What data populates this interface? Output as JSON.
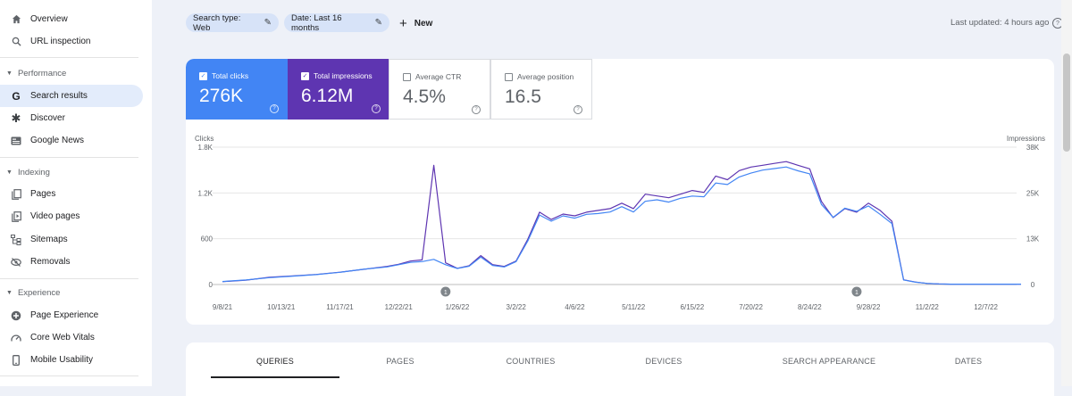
{
  "sidebar": {
    "items_top": [
      {
        "label": "Overview",
        "icon": "home-icon"
      },
      {
        "label": "URL inspection",
        "icon": "search-icon"
      }
    ],
    "sections": [
      {
        "title": "Performance",
        "items": [
          {
            "label": "Search results",
            "icon": "google-g-icon",
            "active": true
          },
          {
            "label": "Discover",
            "icon": "asterisk-icon"
          },
          {
            "label": "Google News",
            "icon": "news-icon"
          }
        ]
      },
      {
        "title": "Indexing",
        "items": [
          {
            "label": "Pages",
            "icon": "pages-icon"
          },
          {
            "label": "Video pages",
            "icon": "video-pages-icon"
          },
          {
            "label": "Sitemaps",
            "icon": "sitemap-icon"
          },
          {
            "label": "Removals",
            "icon": "removals-icon"
          }
        ]
      },
      {
        "title": "Experience",
        "items": [
          {
            "label": "Page Experience",
            "icon": "page-experience-icon"
          },
          {
            "label": "Core Web Vitals",
            "icon": "gauge-icon"
          },
          {
            "label": "Mobile Usability",
            "icon": "mobile-icon"
          }
        ]
      }
    ]
  },
  "filters": {
    "search_type": "Search type: Web",
    "date": "Date: Last 16 months",
    "new_label": "New"
  },
  "last_updated": "Last updated: 4 hours ago",
  "metrics": {
    "clicks": {
      "label": "Total clicks",
      "value": "276K",
      "checked": true,
      "color": "#4285f4"
    },
    "impressions": {
      "label": "Total impressions",
      "value": "6.12M",
      "checked": true,
      "color": "#5e35b1"
    },
    "ctr": {
      "label": "Average CTR",
      "value": "4.5%",
      "checked": false
    },
    "position": {
      "label": "Average position",
      "value": "16.5",
      "checked": false
    }
  },
  "chart_data": {
    "type": "line",
    "left_axis": {
      "label": "Clicks",
      "ticks": [
        "0",
        "600",
        "1.2K",
        "1.8K"
      ],
      "range": [
        0,
        1800
      ]
    },
    "right_axis": {
      "label": "Impressions",
      "ticks": [
        "0",
        "13K",
        "25K",
        "38K"
      ],
      "range": [
        0,
        38000
      ]
    },
    "x_tick_labels": [
      "9/8/21",
      "10/13/21",
      "11/17/21",
      "12/22/21",
      "1/26/22",
      "3/2/22",
      "4/6/22",
      "5/11/22",
      "6/15/22",
      "7/20/22",
      "8/24/22",
      "9/28/22",
      "11/2/22",
      "12/7/22"
    ],
    "annotations": [
      "1",
      "1"
    ],
    "series": [
      {
        "name": "Total clicks",
        "color": "#4285f4",
        "axis": "left",
        "x": [
          "9/8/21",
          "9/22/21",
          "10/6/21",
          "10/20/21",
          "11/3/21",
          "11/17/21",
          "12/1/21",
          "12/15/21",
          "12/22/21",
          "12/29/21",
          "1/5/22",
          "1/12/22",
          "1/19/22",
          "1/26/22",
          "2/2/22",
          "2/9/22",
          "2/16/22",
          "2/23/22",
          "3/2/22",
          "3/9/22",
          "3/16/22",
          "3/23/22",
          "3/30/22",
          "4/6/22",
          "4/13/22",
          "4/20/22",
          "4/27/22",
          "5/4/22",
          "5/11/22",
          "5/18/22",
          "5/25/22",
          "6/1/22",
          "6/8/22",
          "6/15/22",
          "6/22/22",
          "6/29/22",
          "7/6/22",
          "7/13/22",
          "7/20/22",
          "7/27/22",
          "8/3/22",
          "8/10/22",
          "8/17/22",
          "8/24/22",
          "8/31/22",
          "9/7/22",
          "9/14/22",
          "9/21/22",
          "9/28/22",
          "10/5/22",
          "10/12/22",
          "10/19/22",
          "10/26/22",
          "11/2/22",
          "11/9/22",
          "11/16/22",
          "11/23/22",
          "11/30/22",
          "12/7/22",
          "12/14/22",
          "12/21/22",
          "12/28/22"
        ],
        "y": [
          40,
          60,
          90,
          110,
          130,
          160,
          200,
          230,
          260,
          290,
          300,
          330,
          260,
          210,
          240,
          360,
          250,
          230,
          300,
          570,
          910,
          830,
          900,
          870,
          920,
          930,
          950,
          1020,
          950,
          1090,
          1110,
          1080,
          1130,
          1160,
          1150,
          1330,
          1310,
          1410,
          1460,
          1500,
          1520,
          1540,
          1490,
          1450,
          1050,
          880,
          1000,
          960,
          1030,
          920,
          800,
          60,
          30,
          15,
          8,
          5,
          5,
          5,
          5,
          5,
          5,
          5
        ]
      },
      {
        "name": "Total impressions",
        "color": "#5e35b1",
        "axis": "right",
        "x": [
          "9/8/21",
          "9/22/21",
          "10/6/21",
          "10/20/21",
          "11/3/21",
          "11/17/21",
          "12/1/21",
          "12/15/21",
          "12/22/21",
          "12/29/21",
          "1/5/22",
          "1/12/22",
          "1/19/22",
          "1/26/22",
          "2/2/22",
          "2/9/22",
          "2/16/22",
          "2/23/22",
          "3/2/22",
          "3/9/22",
          "3/16/22",
          "3/23/22",
          "3/30/22",
          "4/6/22",
          "4/13/22",
          "4/20/22",
          "4/27/22",
          "5/4/22",
          "5/11/22",
          "5/18/22",
          "5/25/22",
          "6/1/22",
          "6/8/22",
          "6/15/22",
          "6/22/22",
          "6/29/22",
          "7/6/22",
          "7/13/22",
          "7/20/22",
          "7/27/22",
          "8/3/22",
          "8/10/22",
          "8/17/22",
          "8/24/22",
          "8/31/22",
          "9/7/22",
          "9/14/22",
          "9/21/22",
          "9/28/22",
          "10/5/22",
          "10/12/22",
          "10/19/22",
          "10/26/22",
          "11/2/22",
          "11/9/22",
          "11/16/22",
          "11/23/22",
          "11/30/22",
          "12/7/22",
          "12/14/22",
          "12/21/22",
          "12/28/22"
        ],
        "y": [
          800,
          1200,
          2000,
          2400,
          2800,
          3400,
          4200,
          5000,
          5600,
          6500,
          6800,
          33000,
          6000,
          4500,
          5200,
          8000,
          5500,
          5000,
          6500,
          12500,
          20000,
          18000,
          19500,
          19000,
          20000,
          20500,
          21000,
          22500,
          21000,
          25000,
          24500,
          24000,
          25000,
          26000,
          25500,
          30000,
          29000,
          31500,
          32500,
          33000,
          33500,
          34000,
          33000,
          32000,
          23000,
          18500,
          21000,
          20000,
          22500,
          20500,
          17500,
          1300,
          700,
          300,
          150,
          100,
          100,
          100,
          100,
          100,
          100,
          100
        ]
      }
    ]
  },
  "tabs": [
    "QUERIES",
    "PAGES",
    "COUNTRIES",
    "DEVICES",
    "SEARCH APPEARANCE",
    "DATES"
  ]
}
